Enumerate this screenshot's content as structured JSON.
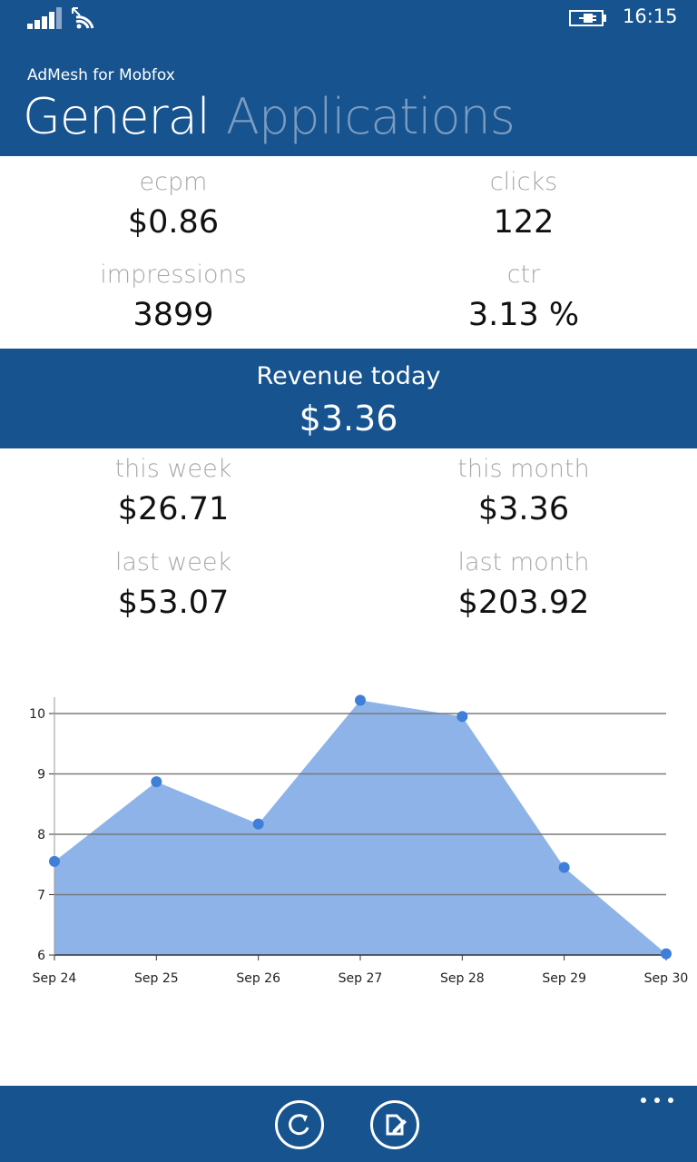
{
  "status_bar": {
    "time": "16:15",
    "signal_icon": "signal-icon",
    "wifi_icon": "wifi-icon",
    "battery_icon": "battery-charging-icon"
  },
  "app": {
    "title": "AdMesh for Mobfox"
  },
  "pivot": {
    "active": "General",
    "inactive": "Applications"
  },
  "stats": {
    "ecpm": {
      "label": "ecpm",
      "value": "$0.86"
    },
    "clicks": {
      "label": "clicks",
      "value": "122"
    },
    "impressions": {
      "label": "impressions",
      "value": "3899"
    },
    "ctr": {
      "label": "ctr",
      "value": "3.13 %"
    }
  },
  "revenue": {
    "today_label": "Revenue today",
    "today_value": "$3.36",
    "this_week": {
      "label": "this week",
      "value": "$26.71"
    },
    "this_month": {
      "label": "this month",
      "value": "$3.36"
    },
    "last_week": {
      "label": "last week",
      "value": "$53.07"
    },
    "last_month": {
      "label": "last month",
      "value": "$203.92"
    }
  },
  "chart_data": {
    "type": "area",
    "categories": [
      "Sep 24",
      "Sep 25",
      "Sep 26",
      "Sep 27",
      "Sep 28",
      "Sep 29",
      "Sep 30"
    ],
    "values": [
      7.55,
      8.87,
      8.17,
      10.22,
      9.95,
      7.45,
      6.02
    ],
    "yticks": [
      6,
      7,
      8,
      9,
      10
    ],
    "ylim": [
      6,
      10.27
    ],
    "grid": true,
    "fill_color": "#8db3e8",
    "point_color": "#3f7fd8"
  },
  "app_bar": {
    "refresh_icon": "refresh-icon",
    "edit_icon": "edit-icon",
    "more_icon": "more-icon"
  },
  "colors": {
    "accent": "#16538f",
    "inactive_pivot": "#7b9cc0",
    "label_gray": "#a8a8a8"
  }
}
